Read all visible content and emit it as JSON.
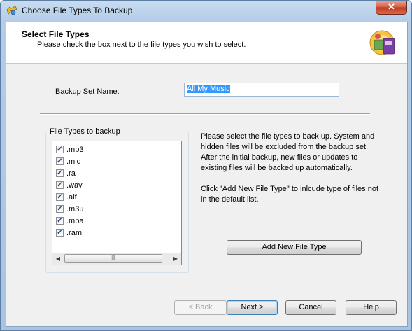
{
  "window": {
    "title": "Choose File Types To Backup",
    "close_glyph": "✕"
  },
  "header": {
    "title": "Select File Types",
    "subtitle": "Please check the box next to the file types you wish to select."
  },
  "backup_set": {
    "label": "Backup Set Name:",
    "value": "All My Music"
  },
  "file_types": {
    "group_label": "File Types to backup",
    "items": [
      {
        "label": ".mp3",
        "checked": true
      },
      {
        "label": ".mid",
        "checked": true
      },
      {
        "label": ".ra",
        "checked": true
      },
      {
        "label": ".wav",
        "checked": true
      },
      {
        "label": ".aif",
        "checked": true
      },
      {
        "label": ".m3u",
        "checked": true
      },
      {
        "label": ".mpa",
        "checked": true
      },
      {
        "label": ".ram",
        "checked": true
      }
    ],
    "check_glyph": "✓",
    "scroll_left": "◀",
    "scroll_right": "▶",
    "thumb_grip": "|||"
  },
  "info": {
    "text1": "Please select the file types to back up. System and hidden files will be excluded from the backup set. After the initial backup, new files or updates to existing files will be backed up automatically.",
    "text2": "Click \"Add New File Type\" to inlcude type of files not in the default list."
  },
  "buttons": {
    "add": "Add New File Type",
    "back": "< Back",
    "next": "Next >",
    "cancel": "Cancel",
    "help": "Help"
  }
}
